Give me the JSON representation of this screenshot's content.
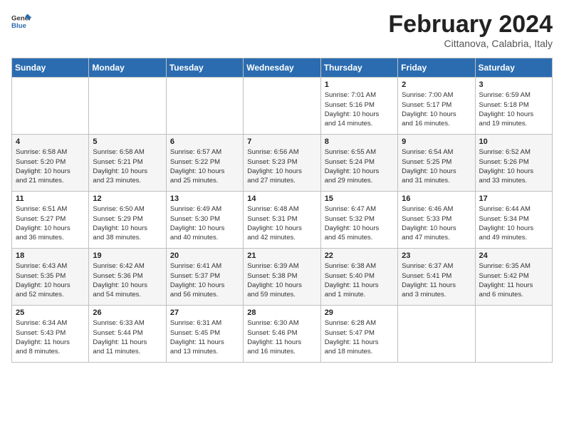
{
  "header": {
    "logo_general": "General",
    "logo_blue": "Blue",
    "main_title": "February 2024",
    "subtitle": "Cittanova, Calabria, Italy"
  },
  "calendar": {
    "columns": [
      "Sunday",
      "Monday",
      "Tuesday",
      "Wednesday",
      "Thursday",
      "Friday",
      "Saturday"
    ],
    "rows": [
      [
        {
          "day": "",
          "info": ""
        },
        {
          "day": "",
          "info": ""
        },
        {
          "day": "",
          "info": ""
        },
        {
          "day": "",
          "info": ""
        },
        {
          "day": "1",
          "info": "Sunrise: 7:01 AM\nSunset: 5:16 PM\nDaylight: 10 hours\nand 14 minutes."
        },
        {
          "day": "2",
          "info": "Sunrise: 7:00 AM\nSunset: 5:17 PM\nDaylight: 10 hours\nand 16 minutes."
        },
        {
          "day": "3",
          "info": "Sunrise: 6:59 AM\nSunset: 5:18 PM\nDaylight: 10 hours\nand 19 minutes."
        }
      ],
      [
        {
          "day": "4",
          "info": "Sunrise: 6:58 AM\nSunset: 5:20 PM\nDaylight: 10 hours\nand 21 minutes."
        },
        {
          "day": "5",
          "info": "Sunrise: 6:58 AM\nSunset: 5:21 PM\nDaylight: 10 hours\nand 23 minutes."
        },
        {
          "day": "6",
          "info": "Sunrise: 6:57 AM\nSunset: 5:22 PM\nDaylight: 10 hours\nand 25 minutes."
        },
        {
          "day": "7",
          "info": "Sunrise: 6:56 AM\nSunset: 5:23 PM\nDaylight: 10 hours\nand 27 minutes."
        },
        {
          "day": "8",
          "info": "Sunrise: 6:55 AM\nSunset: 5:24 PM\nDaylight: 10 hours\nand 29 minutes."
        },
        {
          "day": "9",
          "info": "Sunrise: 6:54 AM\nSunset: 5:25 PM\nDaylight: 10 hours\nand 31 minutes."
        },
        {
          "day": "10",
          "info": "Sunrise: 6:52 AM\nSunset: 5:26 PM\nDaylight: 10 hours\nand 33 minutes."
        }
      ],
      [
        {
          "day": "11",
          "info": "Sunrise: 6:51 AM\nSunset: 5:27 PM\nDaylight: 10 hours\nand 36 minutes."
        },
        {
          "day": "12",
          "info": "Sunrise: 6:50 AM\nSunset: 5:29 PM\nDaylight: 10 hours\nand 38 minutes."
        },
        {
          "day": "13",
          "info": "Sunrise: 6:49 AM\nSunset: 5:30 PM\nDaylight: 10 hours\nand 40 minutes."
        },
        {
          "day": "14",
          "info": "Sunrise: 6:48 AM\nSunset: 5:31 PM\nDaylight: 10 hours\nand 42 minutes."
        },
        {
          "day": "15",
          "info": "Sunrise: 6:47 AM\nSunset: 5:32 PM\nDaylight: 10 hours\nand 45 minutes."
        },
        {
          "day": "16",
          "info": "Sunrise: 6:46 AM\nSunset: 5:33 PM\nDaylight: 10 hours\nand 47 minutes."
        },
        {
          "day": "17",
          "info": "Sunrise: 6:44 AM\nSunset: 5:34 PM\nDaylight: 10 hours\nand 49 minutes."
        }
      ],
      [
        {
          "day": "18",
          "info": "Sunrise: 6:43 AM\nSunset: 5:35 PM\nDaylight: 10 hours\nand 52 minutes."
        },
        {
          "day": "19",
          "info": "Sunrise: 6:42 AM\nSunset: 5:36 PM\nDaylight: 10 hours\nand 54 minutes."
        },
        {
          "day": "20",
          "info": "Sunrise: 6:41 AM\nSunset: 5:37 PM\nDaylight: 10 hours\nand 56 minutes."
        },
        {
          "day": "21",
          "info": "Sunrise: 6:39 AM\nSunset: 5:38 PM\nDaylight: 10 hours\nand 59 minutes."
        },
        {
          "day": "22",
          "info": "Sunrise: 6:38 AM\nSunset: 5:40 PM\nDaylight: 11 hours\nand 1 minute."
        },
        {
          "day": "23",
          "info": "Sunrise: 6:37 AM\nSunset: 5:41 PM\nDaylight: 11 hours\nand 3 minutes."
        },
        {
          "day": "24",
          "info": "Sunrise: 6:35 AM\nSunset: 5:42 PM\nDaylight: 11 hours\nand 6 minutes."
        }
      ],
      [
        {
          "day": "25",
          "info": "Sunrise: 6:34 AM\nSunset: 5:43 PM\nDaylight: 11 hours\nand 8 minutes."
        },
        {
          "day": "26",
          "info": "Sunrise: 6:33 AM\nSunset: 5:44 PM\nDaylight: 11 hours\nand 11 minutes."
        },
        {
          "day": "27",
          "info": "Sunrise: 6:31 AM\nSunset: 5:45 PM\nDaylight: 11 hours\nand 13 minutes."
        },
        {
          "day": "28",
          "info": "Sunrise: 6:30 AM\nSunset: 5:46 PM\nDaylight: 11 hours\nand 16 minutes."
        },
        {
          "day": "29",
          "info": "Sunrise: 6:28 AM\nSunset: 5:47 PM\nDaylight: 11 hours\nand 18 minutes."
        },
        {
          "day": "",
          "info": ""
        },
        {
          "day": "",
          "info": ""
        }
      ]
    ]
  }
}
